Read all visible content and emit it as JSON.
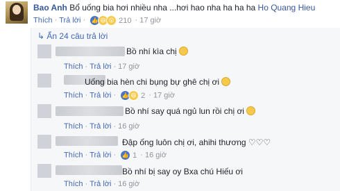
{
  "post_comment": {
    "author": "Bao Anh",
    "text": "Bổ uống bia hơi nhiều nha ...hơi hao nha ha ha ha",
    "tag": "Ho Quang Hieu",
    "like_label": "Thích",
    "reply_label": "Trả lời",
    "reaction_count": "210",
    "time": "17 giờ"
  },
  "hidden_replies_label": "Ẩn 24 câu trả lời",
  "replies": [
    {
      "text": "Bồ nhí kìa chị",
      "like_label": "Thích",
      "reply_label": "Trả lời",
      "reaction_count": "",
      "time": "17 giờ",
      "emoji": "smile-emoji"
    },
    {
      "text": "Uống bia hèn chi bụng bự ghê chị ơi",
      "like_label": "Thích",
      "reply_label": "Trả lời",
      "reaction_count": "2",
      "time": "17 giờ",
      "emoji": "laugh-emoji"
    },
    {
      "text": "Bồ nhí say quá ngủ lun rồi chị ơi",
      "like_label": "Thích",
      "reply_label": "Trả lời",
      "reaction_count": "",
      "time": "16 giờ",
      "emoji": "laugh-emoji"
    },
    {
      "text": "Đập ống luôn chị ơi, ahihi thương ♡♡♡",
      "like_label": "Thích",
      "reply_label": "Trả lời",
      "reaction_count": "1",
      "time": "16 giờ",
      "emoji": ""
    },
    {
      "text": "Bồ nhí bị say oy Bxa chú Hiếu ơi",
      "like_label": "Thích",
      "reply_label": "Trả lời",
      "reaction_count": "",
      "time": "16 giờ",
      "emoji": ""
    }
  ],
  "colors": {
    "link": "#365899",
    "action": "#4267b2",
    "meta": "#90949c",
    "thread_bg": "#f6f7f9",
    "like": "#4c75c3",
    "haha": "#f7c94a"
  }
}
